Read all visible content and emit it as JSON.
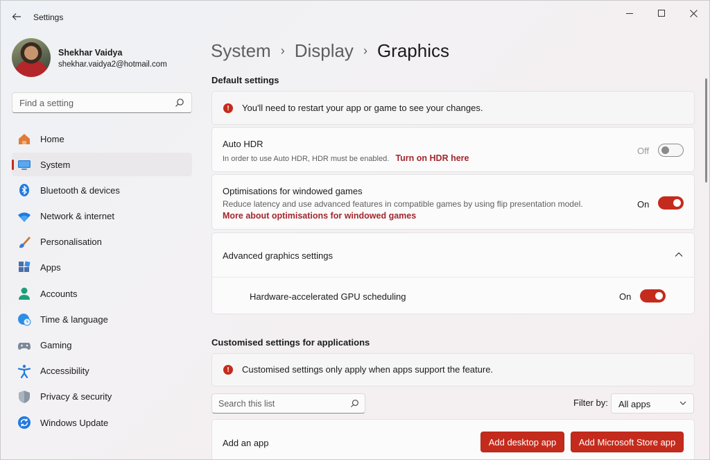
{
  "window": {
    "app_title": "Settings",
    "controls": {
      "minimize": "minimize-icon",
      "maximize": "maximize-icon",
      "close": "close-icon"
    }
  },
  "profile": {
    "name": "Shekhar Vaidya",
    "email": "shekhar.vaidya2@hotmail.com"
  },
  "sidebar": {
    "search_placeholder": "Find a setting",
    "items": [
      {
        "label": "Home",
        "icon": "home-icon"
      },
      {
        "label": "System",
        "icon": "system-icon",
        "active": true
      },
      {
        "label": "Bluetooth & devices",
        "icon": "bluetooth-icon"
      },
      {
        "label": "Network & internet",
        "icon": "wifi-icon"
      },
      {
        "label": "Personalisation",
        "icon": "brush-icon"
      },
      {
        "label": "Apps",
        "icon": "apps-icon"
      },
      {
        "label": "Accounts",
        "icon": "accounts-icon"
      },
      {
        "label": "Time & language",
        "icon": "globe-clock-icon"
      },
      {
        "label": "Gaming",
        "icon": "gamepad-icon"
      },
      {
        "label": "Accessibility",
        "icon": "accessibility-icon"
      },
      {
        "label": "Privacy & security",
        "icon": "shield-icon"
      },
      {
        "label": "Windows Update",
        "icon": "update-icon"
      }
    ]
  },
  "breadcrumb": [
    "System",
    "Display",
    "Graphics"
  ],
  "default_settings": {
    "title": "Default settings",
    "restart_notice": "You'll need to restart your app or game to see your changes.",
    "auto_hdr": {
      "title": "Auto HDR",
      "desc": "In order to use Auto HDR, HDR must be enabled.",
      "link": "Turn on HDR here",
      "state_label": "Off",
      "enabled": false
    },
    "windowed_games": {
      "title": "Optimisations for windowed games",
      "desc": "Reduce latency and use advanced features in compatible games by using flip presentation model.",
      "link": "More about optimisations for windowed games",
      "state_label": "On",
      "enabled": true
    },
    "advanced": {
      "title": "Advanced graphics settings",
      "expanded": true,
      "gpu_scheduling": {
        "title": "Hardware-accelerated GPU scheduling",
        "state_label": "On",
        "enabled": true
      }
    }
  },
  "custom_settings": {
    "title": "Customised settings for applications",
    "notice": "Customised settings only apply when apps support the feature.",
    "search_placeholder": "Search this list",
    "filter_label": "Filter by:",
    "filter_value": "All apps",
    "add_app_label": "Add an app",
    "add_desktop_btn": "Add desktop app",
    "add_store_btn": "Add Microsoft Store app"
  },
  "colors": {
    "accent": "#c42b1c",
    "link": "#a4262c"
  }
}
